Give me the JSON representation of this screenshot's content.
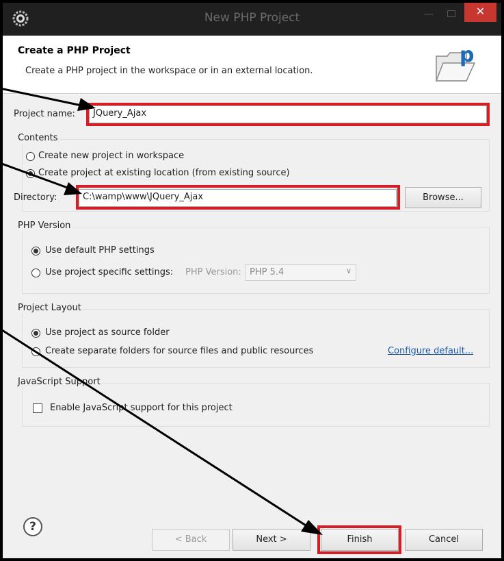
{
  "window": {
    "title": "New PHP Project",
    "min_symbol": "—",
    "close_symbol": "✕"
  },
  "header": {
    "title": "Create a PHP Project",
    "description": "Create a PHP project in the workspace or in an external location."
  },
  "project": {
    "name_label": "Project name:",
    "name_value": "JQuery_Ajax"
  },
  "contents": {
    "group_label": "Contents",
    "option_new": "Create new project in workspace",
    "option_existing": "Create project at existing location (from existing source)",
    "selected": "existing",
    "directory_label": "Directory:",
    "directory_value": "C:\\wamp\\www\\JQuery_Ajax",
    "browse_label": "Browse..."
  },
  "php_version": {
    "group_label": "PHP Version",
    "option_default": "Use default PHP settings",
    "option_specific": "Use project specific settings:",
    "selected": "default",
    "version_label": "PHP Version:",
    "version_value": "PHP 5.4"
  },
  "layout": {
    "group_label": "Project Layout",
    "option_source": "Use project as source folder",
    "option_separate": "Create separate folders for source files and public resources",
    "selected": "source",
    "configure_link": "Configure default..."
  },
  "javascript": {
    "group_label": "JavaScript Support",
    "checkbox_label": "Enable JavaScript support for this project",
    "checked": false
  },
  "buttons": {
    "help": "?",
    "back": "< Back",
    "next": "Next >",
    "finish": "Finish",
    "cancel": "Cancel"
  },
  "colors": {
    "highlight": "#d41f26",
    "link": "#1f5aa6",
    "close_button": "#c7372f",
    "title_bar": "#202020"
  },
  "icons": [
    "eclipse-gear-icon",
    "php-project-folder-icon",
    "help-icon",
    "chevron-down-icon"
  ]
}
